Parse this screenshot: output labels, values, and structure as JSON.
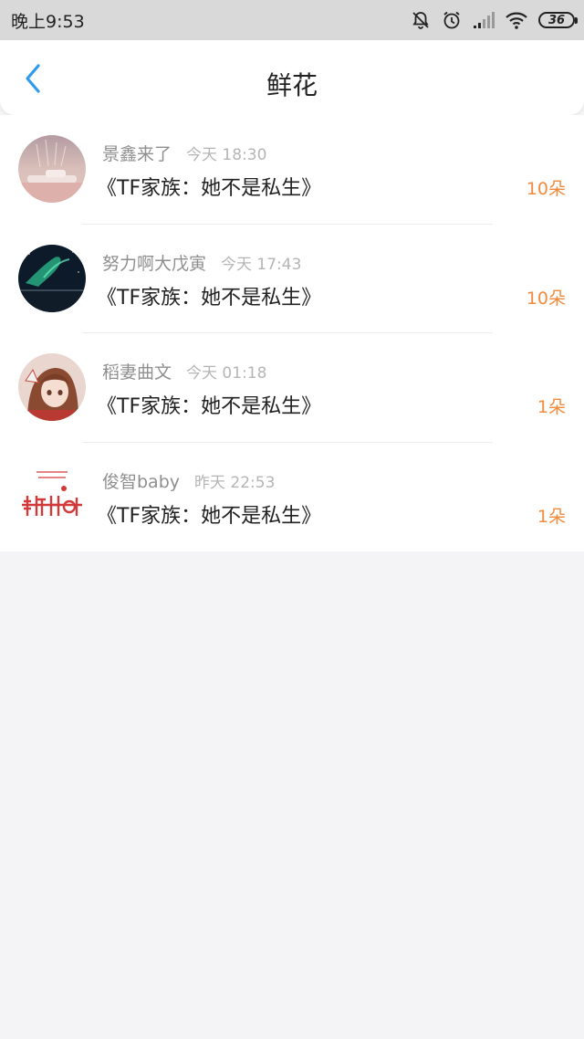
{
  "status_bar": {
    "time": "晚上9:53",
    "battery": "36",
    "icons": [
      "bell-muted-icon",
      "alarm-icon",
      "signal-icon",
      "wifi-icon",
      "battery-icon"
    ]
  },
  "navbar": {
    "back_icon": "chevron-left-icon",
    "title": "鲜花",
    "accent_color": "#2f9bf0"
  },
  "records": [
    {
      "user": "景鑫来了",
      "time": "今天 18:30",
      "book": "《TF家族：她不是私生》",
      "amount": "10朵",
      "avatar": "avatar-sunset-photo"
    },
    {
      "user": "努力啊大戊寅",
      "time": "今天 17:43",
      "book": "《TF家族：她不是私生》",
      "amount": "10朵",
      "avatar": "avatar-aurora-photo"
    },
    {
      "user": "稻妻曲文",
      "time": "今天 01:18",
      "book": "《TF家族：她不是私生》",
      "amount": "1朵",
      "avatar": "avatar-anime-girl"
    },
    {
      "user": "俊智baby",
      "time": "昨天 22:53",
      "book": "《TF家族：她不是私生》",
      "amount": "1朵",
      "avatar": "avatar-red-logo"
    }
  ],
  "colors": {
    "amount": "#f08a3c",
    "username": "#8f8f8f",
    "timestamp": "#b5b5b5",
    "background": "#f4f3f5"
  }
}
